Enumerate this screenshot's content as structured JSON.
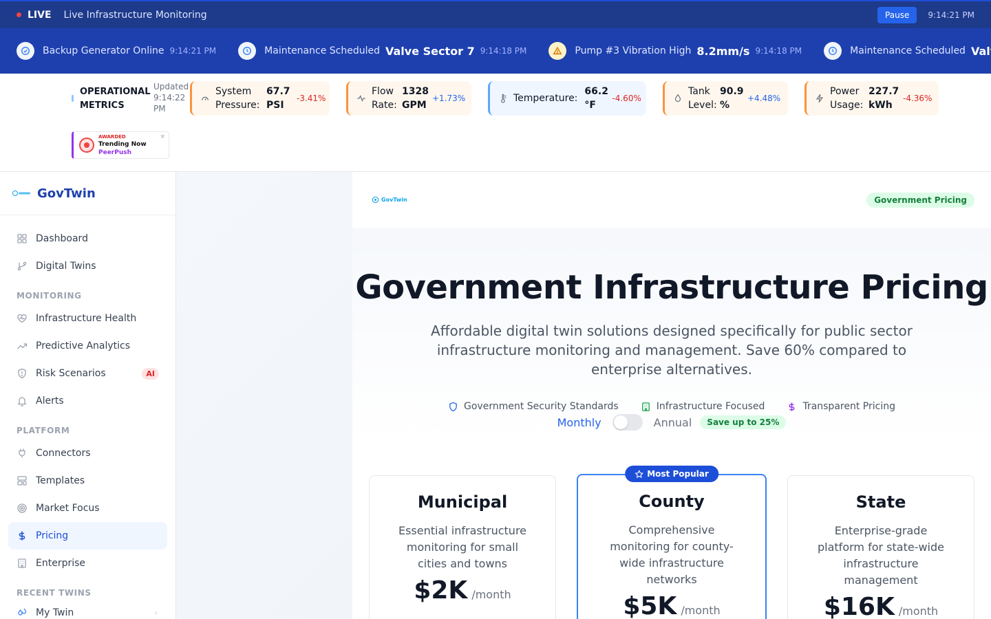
{
  "livebar": {
    "live_label": "LIVE",
    "title": "Live Infrastructure Monitoring",
    "pause_label": "Pause",
    "time": "9:14:21 PM"
  },
  "ticker": [
    {
      "text": "Backup Generator Online",
      "value": "",
      "time": "9:14:21 PM",
      "icon": "check-circle-icon"
    },
    {
      "text": "Maintenance Scheduled",
      "value": "Valve Sector 7",
      "time": "9:14:18 PM",
      "icon": "clock-icon"
    },
    {
      "text": "Pump #3 Vibration High",
      "value": "8.2mm/s",
      "time": "9:14:18 PM",
      "icon": "warning-icon"
    },
    {
      "text": "Maintenance Scheduled",
      "value": "Valve Sect",
      "time": "",
      "icon": "clock-icon"
    }
  ],
  "metrics": {
    "title": "OPERATIONAL METRICS",
    "updated": "Updated 9:14:22 PM",
    "cards": [
      {
        "name": "System Pressure:",
        "value": "67.7 PSI",
        "change": "-3.41%",
        "trend": "down"
      },
      {
        "name": "Flow Rate:",
        "value": "1328 GPM",
        "change": "+1.73%",
        "trend": "up"
      },
      {
        "name": "Temperature:",
        "value": "66.2 °F",
        "change": "-4.60%",
        "trend": "down"
      },
      {
        "name": "Tank Level:",
        "value": "90.9 %",
        "change": "+4.48%",
        "trend": "up"
      },
      {
        "name": "Power Usage:",
        "value": "227.7 kWh",
        "change": "-4.36%",
        "trend": "down"
      }
    ]
  },
  "award": {
    "small": "AWARDED",
    "main": "Trending Now",
    "brand": "PeerPush",
    "close": "×"
  },
  "sidebar": {
    "brand": "GovTwin",
    "logo_text": "GovTwin",
    "items_top": [
      {
        "label": "Dashboard"
      },
      {
        "label": "Digital Twins"
      }
    ],
    "section_monitoring": "MONITORING",
    "items_monitoring": [
      {
        "label": "Infrastructure Health"
      },
      {
        "label": "Predictive Analytics"
      },
      {
        "label": "Risk Scenarios",
        "badge": "AI"
      },
      {
        "label": "Alerts"
      }
    ],
    "section_platform": "PLATFORM",
    "items_platform": [
      {
        "label": "Connectors"
      },
      {
        "label": "Templates"
      },
      {
        "label": "Market Focus"
      },
      {
        "label": "Pricing"
      },
      {
        "label": "Enterprise"
      }
    ],
    "section_recent": "RECENT TWINS",
    "items_recent": [
      {
        "label": "My Twin"
      }
    ]
  },
  "header": {
    "logo_text": "GovTwin",
    "pill": "Government Pricing"
  },
  "hero": {
    "title": "Government Infrastructure Pricing",
    "subtitle": "Affordable digital twin solutions designed specifically for public sector infrastructure monitoring and management. Save 60% compared to enterprise alternatives.",
    "features": [
      "Government Security Standards",
      "Infrastructure Focused",
      "Transparent Pricing"
    ],
    "toggle_monthly": "Monthly",
    "toggle_annual": "Annual",
    "save_badge": "Save up to 25%"
  },
  "plans": [
    {
      "name": "Municipal",
      "desc": "Essential infrastructure monitoring for small cities and towns",
      "price": "$2K",
      "period": "/month"
    },
    {
      "name": "County",
      "desc": "Comprehensive monitoring for county-wide infrastructure networks",
      "price": "$5K",
      "period": "/month",
      "badge": "Most Popular"
    },
    {
      "name": "State",
      "desc": "Enterprise-grade platform for state-wide infrastructure management",
      "price": "$16K",
      "period": "/month"
    }
  ],
  "colors": {
    "accent": "#1d4ed8",
    "ticker_bg": "#1e40af",
    "live_bg": "#1e3a8a",
    "success": "#15803d",
    "danger": "#dc2626"
  }
}
